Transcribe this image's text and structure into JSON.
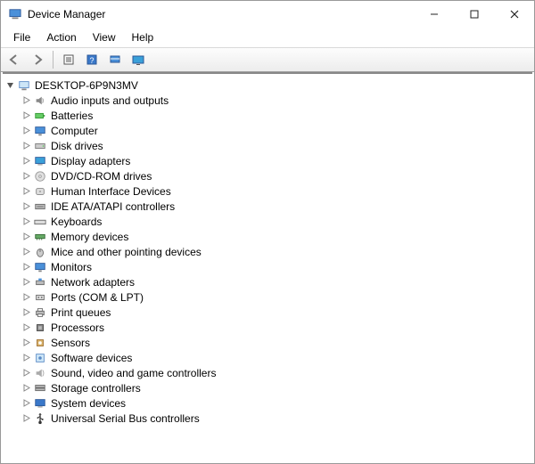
{
  "window": {
    "title": "Device Manager"
  },
  "menu": {
    "file": "File",
    "action": "Action",
    "view": "View",
    "help": "Help"
  },
  "toolbar": {
    "back": "back-icon",
    "forward": "forward-icon",
    "properties": "properties-icon",
    "help": "help-icon",
    "scan": "scan-icon",
    "show": "show-icon"
  },
  "tree": {
    "root": {
      "label": "DESKTOP-6P9N3MV",
      "icon": "computer"
    },
    "children": [
      {
        "label": "Audio inputs and outputs",
        "icon": "audio"
      },
      {
        "label": "Batteries",
        "icon": "battery"
      },
      {
        "label": "Computer",
        "icon": "monitor"
      },
      {
        "label": "Disk drives",
        "icon": "disk"
      },
      {
        "label": "Display adapters",
        "icon": "display"
      },
      {
        "label": "DVD/CD-ROM drives",
        "icon": "cd"
      },
      {
        "label": "Human Interface Devices",
        "icon": "hid"
      },
      {
        "label": "IDE ATA/ATAPI controllers",
        "icon": "ide"
      },
      {
        "label": "Keyboards",
        "icon": "keyboard"
      },
      {
        "label": "Memory devices",
        "icon": "memory"
      },
      {
        "label": "Mice and other pointing devices",
        "icon": "mouse"
      },
      {
        "label": "Monitors",
        "icon": "monitor"
      },
      {
        "label": "Network adapters",
        "icon": "network"
      },
      {
        "label": "Ports (COM & LPT)",
        "icon": "port"
      },
      {
        "label": "Print queues",
        "icon": "printer"
      },
      {
        "label": "Processors",
        "icon": "cpu"
      },
      {
        "label": "Sensors",
        "icon": "sensor"
      },
      {
        "label": "Software devices",
        "icon": "software"
      },
      {
        "label": "Sound, video and game controllers",
        "icon": "sound"
      },
      {
        "label": "Storage controllers",
        "icon": "storage"
      },
      {
        "label": "System devices",
        "icon": "system"
      },
      {
        "label": "Universal Serial Bus controllers",
        "icon": "usb"
      }
    ]
  }
}
